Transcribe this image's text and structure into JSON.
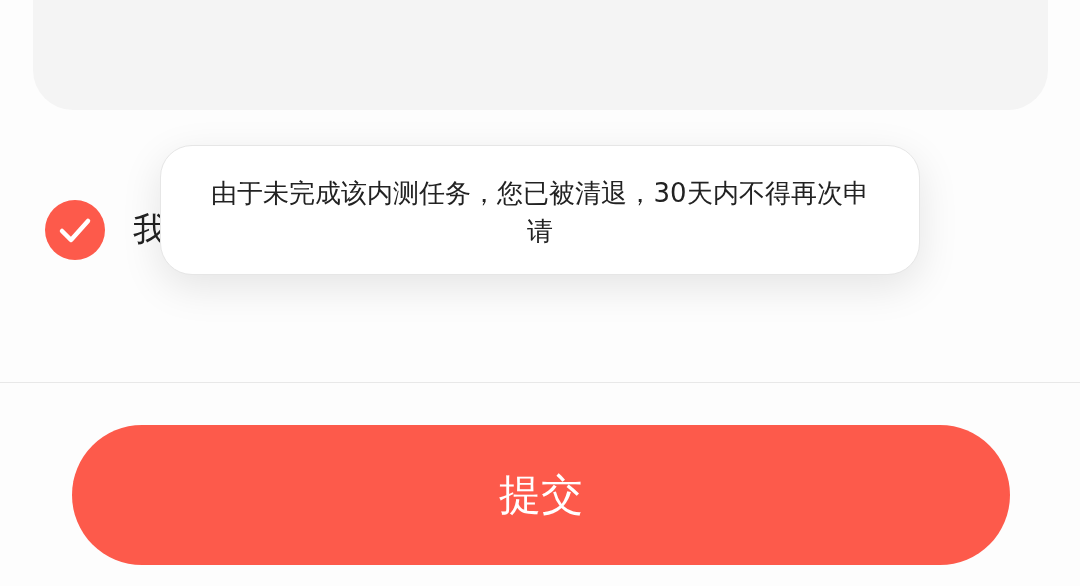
{
  "agreement": {
    "checked": true,
    "label": "我"
  },
  "toast": {
    "message": "由于未完成该内测任务，您已被清退，30天内不得再次申请"
  },
  "submit_button": {
    "label": "提交"
  }
}
